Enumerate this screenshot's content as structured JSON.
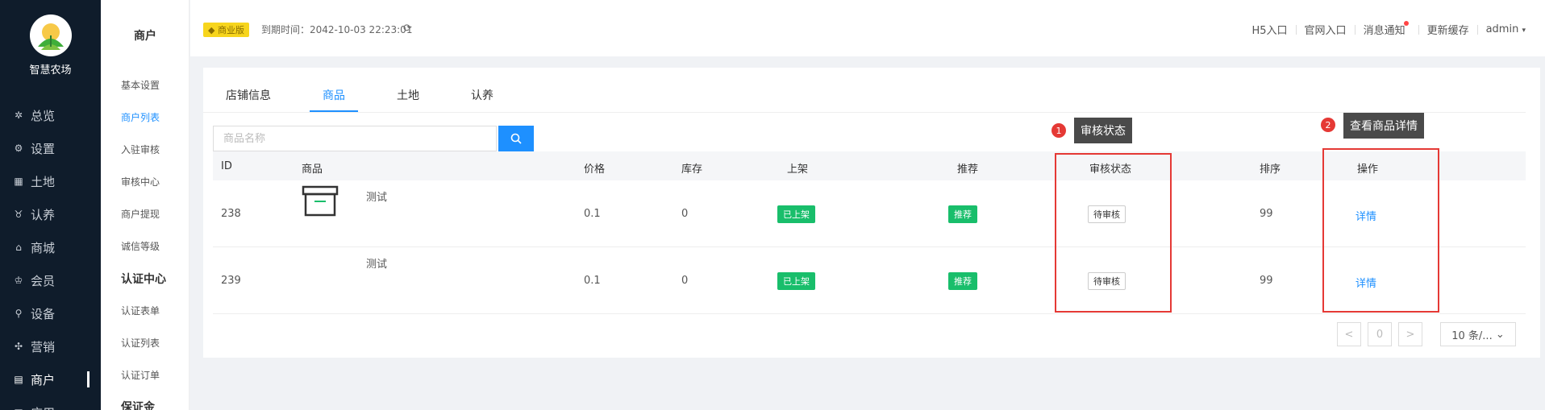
{
  "app": {
    "logo_text": "智慧农场"
  },
  "nav": {
    "items": [
      {
        "label": "总览",
        "icon": "dashboard-icon",
        "glyph": "⚙"
      },
      {
        "label": "设置",
        "icon": "settings-icon",
        "glyph": "⚙"
      },
      {
        "label": "土地",
        "icon": "land-icon",
        "glyph": "▦"
      },
      {
        "label": "认养",
        "icon": "adopt-icon",
        "glyph": "♉"
      },
      {
        "label": "商城",
        "icon": "store-icon",
        "glyph": "⌂"
      },
      {
        "label": "会员",
        "icon": "member-icon",
        "glyph": "♔"
      },
      {
        "label": "设备",
        "icon": "device-icon",
        "glyph": "⚲"
      },
      {
        "label": "营销",
        "icon": "marketing-icon",
        "glyph": "✣"
      },
      {
        "label": "商户",
        "icon": "merchant-icon",
        "glyph": "▤"
      },
      {
        "label": "应用",
        "icon": "apps-icon",
        "glyph": "▣"
      }
    ]
  },
  "submenu": {
    "title": "商户",
    "items": [
      "基本设置",
      "商户列表",
      "入驻审核",
      "审核中心",
      "商户提现",
      "诚信等级"
    ],
    "group1": "认证中心",
    "group1_items": [
      "认证表单",
      "认证列表",
      "认证订单"
    ],
    "group2": "保证金"
  },
  "header": {
    "badge": "商业版",
    "expire": "到期时间：2042-10-03 22:23:01",
    "links": [
      "H5入口",
      "官网入口",
      "消息通知",
      "更新缓存",
      "admin"
    ]
  },
  "tabs": [
    "店铺信息",
    "商品",
    "土地",
    "认养"
  ],
  "search": {
    "placeholder": "商品名称"
  },
  "table": {
    "headers": [
      "ID",
      "商品",
      "价格",
      "库存",
      "上架",
      "推荐",
      "审核状态",
      "排序",
      "操作"
    ],
    "rows": [
      {
        "id": "238",
        "name": "测试",
        "price": "0.1",
        "stock": "0",
        "shelf": "已上架",
        "recommend": "推荐",
        "status": "待审核",
        "sort": "99",
        "action": "详情"
      },
      {
        "id": "239",
        "name": "测试",
        "price": "0.1",
        "stock": "0",
        "shelf": "已上架",
        "recommend": "推荐",
        "status": "待审核",
        "sort": "99",
        "action": "详情"
      }
    ]
  },
  "pagination": {
    "prev": "<",
    "page": "0",
    "next": ">",
    "page_size": "10 条/..."
  },
  "annotations": [
    {
      "num": "1",
      "text": "审核状态"
    },
    {
      "num": "2",
      "text": "查看商品详情"
    }
  ],
  "colors": {
    "accent": "#1e90ff",
    "nav_bg": "#0f1c2b",
    "success": "#19be6b",
    "annotation": "#e53935"
  }
}
